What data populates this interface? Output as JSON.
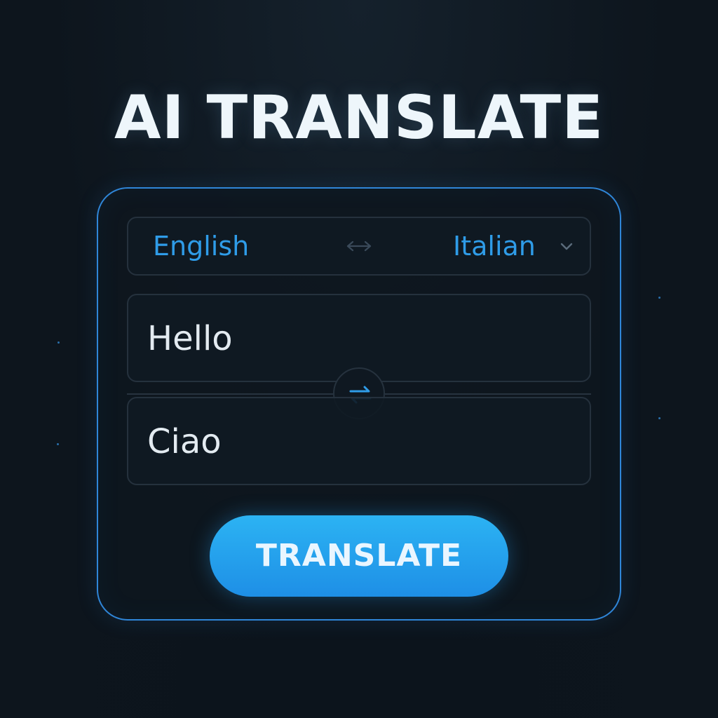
{
  "app": {
    "title": "AI TRANSLATE"
  },
  "languages": {
    "source": "English",
    "target": "Italian",
    "swap_icon": "arrows-left-right-icon",
    "dropdown_icon": "chevron-down-icon"
  },
  "input": {
    "source_text": "Hello",
    "target_text": "Ciao",
    "swap_icon": "swap-arrows-icon"
  },
  "action": {
    "translate_label": "TRANSLATE"
  },
  "colors": {
    "accent": "#2f9ce8",
    "border_accent": "#2f86d8",
    "button_top": "#2cb3f3",
    "button_bottom": "#1e8fe6",
    "background": "#0d151d"
  }
}
